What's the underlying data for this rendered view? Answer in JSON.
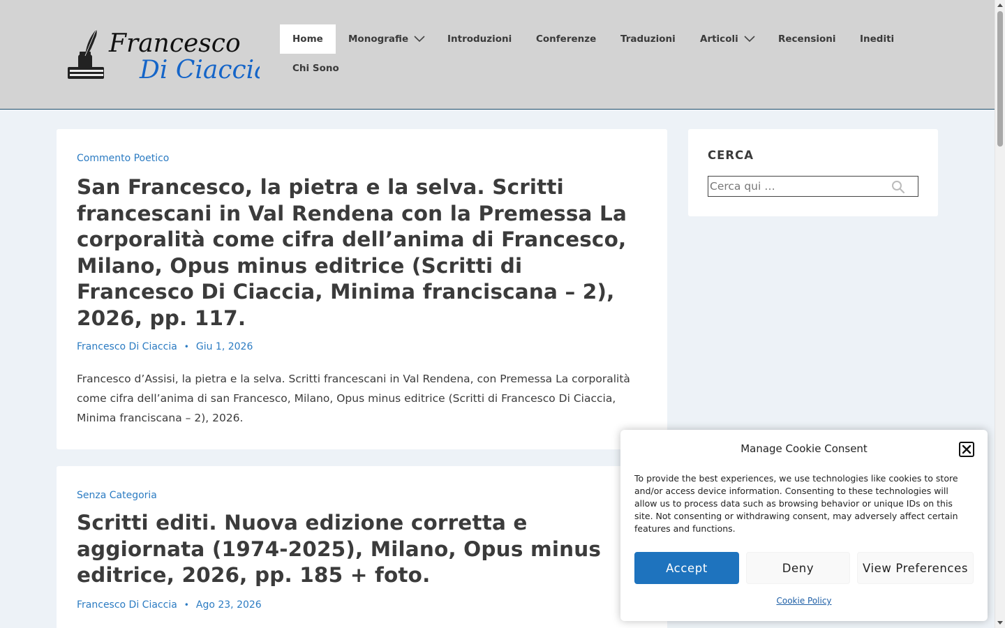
{
  "header": {
    "logo": {
      "line1": "Francesco",
      "line2": "Di Ciaccia"
    },
    "nav": [
      {
        "label": "Home",
        "active": true,
        "has_dropdown": false
      },
      {
        "label": "Monografie",
        "active": false,
        "has_dropdown": true
      },
      {
        "label": "Introduzioni",
        "active": false,
        "has_dropdown": false
      },
      {
        "label": "Conferenze",
        "active": false,
        "has_dropdown": false
      },
      {
        "label": "Traduzioni",
        "active": false,
        "has_dropdown": false
      },
      {
        "label": "Articoli",
        "active": false,
        "has_dropdown": true
      },
      {
        "label": "Recensioni",
        "active": false,
        "has_dropdown": false
      },
      {
        "label": "Inediti",
        "active": false,
        "has_dropdown": false
      },
      {
        "label": "Chi Sono",
        "active": false,
        "has_dropdown": false
      }
    ]
  },
  "posts": [
    {
      "category": "Commento Poetico",
      "title": "San Francesco, la pietra e la selva. Scritti francescani in Val Rendena con la Premessa La corporalità come cifra dell’anima di Francesco, Milano, Opus minus editrice (Scritti di Francesco Di Ciaccia, Minima franciscana – 2), 2026, pp. 117.",
      "author": "Francesco Di Ciaccia",
      "date": "Giu 1, 2026",
      "excerpt": "Francesco d’Assisi, la pietra e la selva. Scritti francescani in Val Rendena, con Premessa La corporalità come cifra dell’anima di san Francesco, Milano, Opus minus editrice (Scritti di Francesco Di Ciaccia, Minima franciscana – 2), 2026."
    },
    {
      "category": "Senza Categoria",
      "title": "Scritti editi. Nuova edizione corretta e aggiornata (1974-2025), Milano, Opus minus editrice, 2026, pp. 185 + foto.",
      "author": "Francesco Di Ciaccia",
      "date": "Ago 23, 2026"
    }
  ],
  "sidebar": {
    "search_widget": {
      "title": "CERCA",
      "placeholder": "Cerca qui …",
      "icon": "search-icon"
    }
  },
  "cookie_banner": {
    "title": "Manage Cookie Consent",
    "text": "To provide the best experiences, we use technologies like cookies to store and/or access device information. Consenting to these technologies will allow us to process data such as browsing behavior or unique IDs on this site. Not consenting or withdrawing consent, may adversely affect certain features and functions.",
    "accept_label": "Accept",
    "deny_label": "Deny",
    "preferences_label": "View Preferences",
    "policy_label": "Cookie Policy"
  },
  "colors": {
    "header_bg": "#d3d3d3",
    "page_bg": "#edf2f7",
    "link": "#2b7bc2",
    "accept_button": "#1e73be",
    "logo_blue": "#1565c8"
  }
}
